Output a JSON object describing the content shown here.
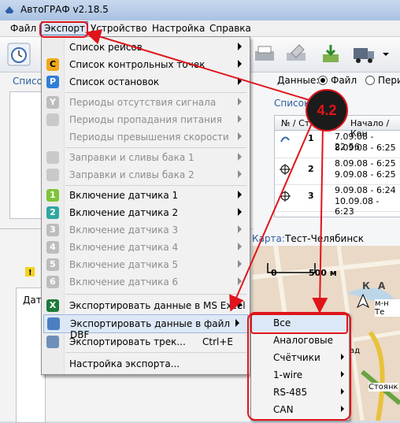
{
  "window": {
    "title": "АвтоГРАФ v2.18.5"
  },
  "menubar": [
    "Файл",
    "Экспорт",
    "Устройство",
    "Настройка",
    "Справка"
  ],
  "background": {
    "list_label": "Список",
    "data_label": "Данные:",
    "data_file": "Файл",
    "data_period": "Пери",
    "stops_label": "Список",
    "grid_headers": [
      "№ / Ст.",
      "Начало / Кон"
    ],
    "grid_rows": [
      {
        "num": "1",
        "lines": [
          "7.09.08 - 22:56",
          "8.09.08 - 6:25"
        ]
      },
      {
        "num": "2",
        "lines": [
          "8.09.08 - 6:25",
          "9.09.08 - 6:25"
        ]
      },
      {
        "num": "3",
        "lines": [
          "9.09.08 - 6:24",
          "10.09.08 - 6:23"
        ]
      }
    ],
    "map_label": "Карта:",
    "map_name": "Тест-Челябинск",
    "map_scale": "500 м",
    "map_text_1": "К А",
    "map_text_2": "м-н Те",
    "map_text_3": "ад",
    "map_text_4": "Стоянк",
    "map_text_5": "0",
    "bottom_label": "Дат"
  },
  "export_menu": {
    "items": [
      {
        "label": "Список рейсов",
        "icon": "",
        "submenu": true,
        "disabled": false
      },
      {
        "label": "Список контрольных точек",
        "icon": "C",
        "submenu": true,
        "disabled": false
      },
      {
        "label": "Список остановок",
        "icon": "P",
        "submenu": true,
        "disabled": false
      },
      {
        "label": "Периоды отсутствия сигнала",
        "icon": "Y",
        "submenu": true,
        "disabled": true
      },
      {
        "label": "Периоды пропадания питания",
        "icon": "",
        "submenu": true,
        "disabled": true
      },
      {
        "label": "Периоды превышения скорости",
        "icon": "",
        "submenu": true,
        "disabled": true
      },
      {
        "label": "Заправки и сливы бака 1",
        "icon": "",
        "submenu": true,
        "disabled": true
      },
      {
        "label": "Заправки и сливы бака 2",
        "icon": "",
        "submenu": true,
        "disabled": true
      },
      {
        "label": "Включение датчика 1",
        "icon": "1",
        "submenu": true,
        "disabled": false
      },
      {
        "label": "Включение датчика 2",
        "icon": "2",
        "submenu": true,
        "disabled": false
      },
      {
        "label": "Включение датчика 3",
        "icon": "3",
        "submenu": true,
        "disabled": true
      },
      {
        "label": "Включение датчика 4",
        "icon": "4",
        "submenu": true,
        "disabled": true
      },
      {
        "label": "Включение датчика 5",
        "icon": "5",
        "submenu": true,
        "disabled": true
      },
      {
        "label": "Включение датчика 6",
        "icon": "6",
        "submenu": true,
        "disabled": true
      },
      {
        "label": "Экспортировать данные в MS Excel",
        "icon": "",
        "submenu": true,
        "disabled": false
      },
      {
        "label": "Экспортировать данные в файл DBF",
        "icon": "",
        "submenu": true,
        "disabled": false
      },
      {
        "label": "Экспортировать трек...",
        "icon": "",
        "shortcut": "Ctrl+E",
        "submenu": false,
        "disabled": false
      },
      {
        "label": "Настройка экспорта...",
        "icon": "",
        "submenu": false,
        "disabled": false
      }
    ]
  },
  "dbf_submenu": {
    "items": [
      {
        "label": "Все",
        "submenu": false
      },
      {
        "label": "Аналоговые",
        "submenu": false
      },
      {
        "label": "Счётчики",
        "submenu": true
      },
      {
        "label": "1-wire",
        "submenu": true
      },
      {
        "label": "RS-485",
        "submenu": true
      },
      {
        "label": "CAN",
        "submenu": true
      }
    ]
  },
  "annotation": {
    "badge": "4.2",
    "color": "#e0141b"
  }
}
